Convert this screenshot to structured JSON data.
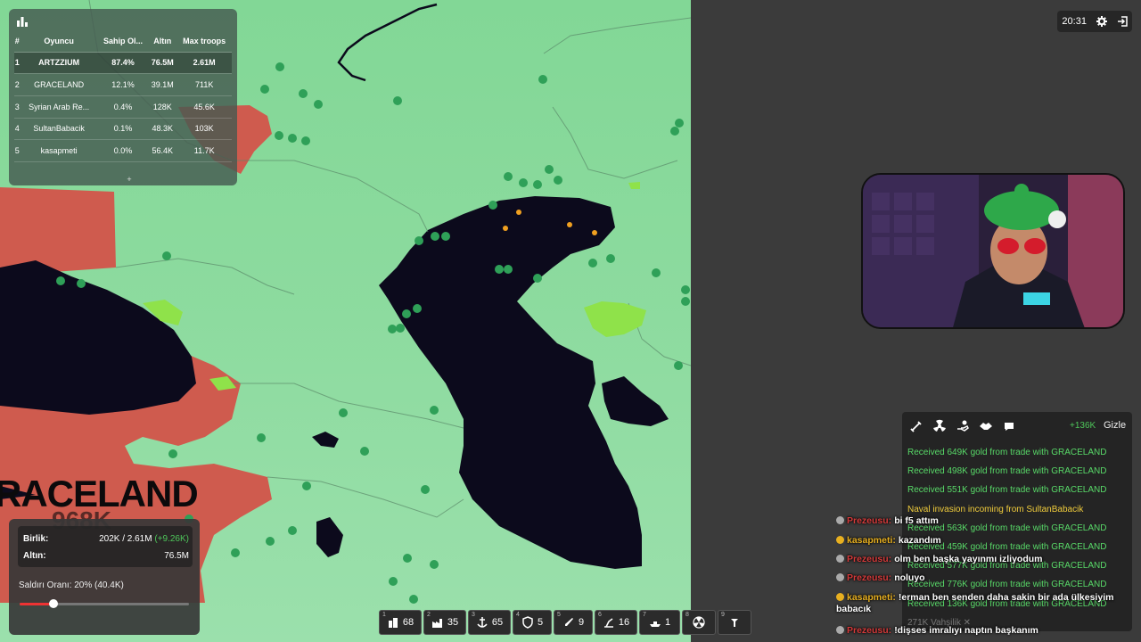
{
  "leaderboard": {
    "headers": [
      "#",
      "Oyuncu",
      "Sahip Ol...",
      "Altın",
      "Max troops"
    ],
    "rows": [
      {
        "rank": "1",
        "name": "ARTZZIUM",
        "owned": "87.4%",
        "gold": "76.5M",
        "troops": "2.61M"
      },
      {
        "rank": "2",
        "name": "GRACELAND",
        "owned": "12.1%",
        "gold": "39.1M",
        "troops": "711K"
      },
      {
        "rank": "3",
        "name": "Syrian Arab Re...",
        "owned": "0.4%",
        "gold": "128K",
        "troops": "45.6K"
      },
      {
        "rank": "4",
        "name": "SultanBabacik",
        "owned": "0.1%",
        "gold": "48.3K",
        "troops": "103K"
      },
      {
        "rank": "5",
        "name": "kasapmeti",
        "owned": "0.0%",
        "gold": "56.4K",
        "troops": "11.7K"
      }
    ],
    "expand_label": "+"
  },
  "map": {
    "territory_label": "RACELAND",
    "territory_sub": "968K"
  },
  "troops": {
    "birlik_label": "Birlik:",
    "birlik_value": "202K / 2.61M",
    "birlik_gain": "(+9.26K)",
    "altin_label": "Altın:",
    "altin_value": "76.5M",
    "attack_label": "Saldırı Oranı: 20% (40.4K)",
    "attack_ratio": 0.2
  },
  "build_bar": [
    {
      "key": "1",
      "icon": "city-icon",
      "count": "68"
    },
    {
      "key": "2",
      "icon": "factory-icon",
      "count": "35"
    },
    {
      "key": "3",
      "icon": "port-icon",
      "count": "65"
    },
    {
      "key": "4",
      "icon": "defense-post-icon",
      "count": "5"
    },
    {
      "key": "5",
      "icon": "missile-silo-icon",
      "count": "9"
    },
    {
      "key": "6",
      "icon": "sam-launcher-icon",
      "count": "16"
    },
    {
      "key": "7",
      "icon": "warship-icon",
      "count": "1"
    },
    {
      "key": "8",
      "icon": "atom-bomb-icon",
      "count": ""
    },
    {
      "key": "9",
      "icon": "hydrogen-bomb-icon",
      "count": ""
    }
  ],
  "top_right": {
    "time": "20:31"
  },
  "events": {
    "gold_gain": "+136K",
    "hide_label": "Gizle",
    "lines": [
      {
        "text": "Received 649K gold from trade with GRACELAND",
        "kind": "green"
      },
      {
        "text": "Received 498K gold from trade with GRACELAND",
        "kind": "green"
      },
      {
        "text": "Received 551K gold from trade with GRACELAND",
        "kind": "green"
      },
      {
        "text": "Naval invasion incoming from SultanBabacik",
        "kind": "yellow"
      },
      {
        "text": "Received 563K gold from trade with GRACELAND",
        "kind": "green"
      },
      {
        "text": "Received 459K gold from trade with GRACELAND",
        "kind": "green"
      },
      {
        "text": "Received 577K gold from trade with GRACELAND",
        "kind": "green"
      },
      {
        "text": "Received 776K gold from trade with GRACELAND",
        "kind": "green"
      },
      {
        "text": "Received 136K gold from trade with GRACELAND",
        "kind": "green"
      },
      {
        "text": "271K Vahşilik ✕",
        "kind": "dim"
      }
    ]
  },
  "chat": [
    {
      "user": "Prezeusu:",
      "user_color": "#d43a3a",
      "badge": "#aaaaaa",
      "msg": "bi f5 attım"
    },
    {
      "user": "kasapmeti:",
      "user_color": "#e8b020",
      "badge": "#e8b020",
      "msg": "kazandım"
    },
    {
      "user": "Prezeusu:",
      "user_color": "#d43a3a",
      "badge": "#aaaaaa",
      "msg": "olm ben başka yayınmı izliyodum"
    },
    {
      "user": "Prezeusu:",
      "user_color": "#d43a3a",
      "badge": "#aaaaaa",
      "msg": "noluyo"
    },
    {
      "user": "kasapmeti:",
      "user_color": "#e8b020",
      "badge": "#e8b020",
      "msg": "!erman ben senden daha sakin bir ada ülkesiyim babacık"
    },
    {
      "user": "Prezeusu:",
      "user_color": "#d43a3a",
      "badge": "#aaaaaa",
      "msg": "!dişses imralıyı naptın başkanım"
    }
  ],
  "colors": {
    "land": "#86d89a",
    "water": "#0c0a1c",
    "enemy": "#cf5b4e",
    "highlight": "#8fe24a",
    "unit": "#2fa058",
    "orange_unit": "#f0a020"
  }
}
